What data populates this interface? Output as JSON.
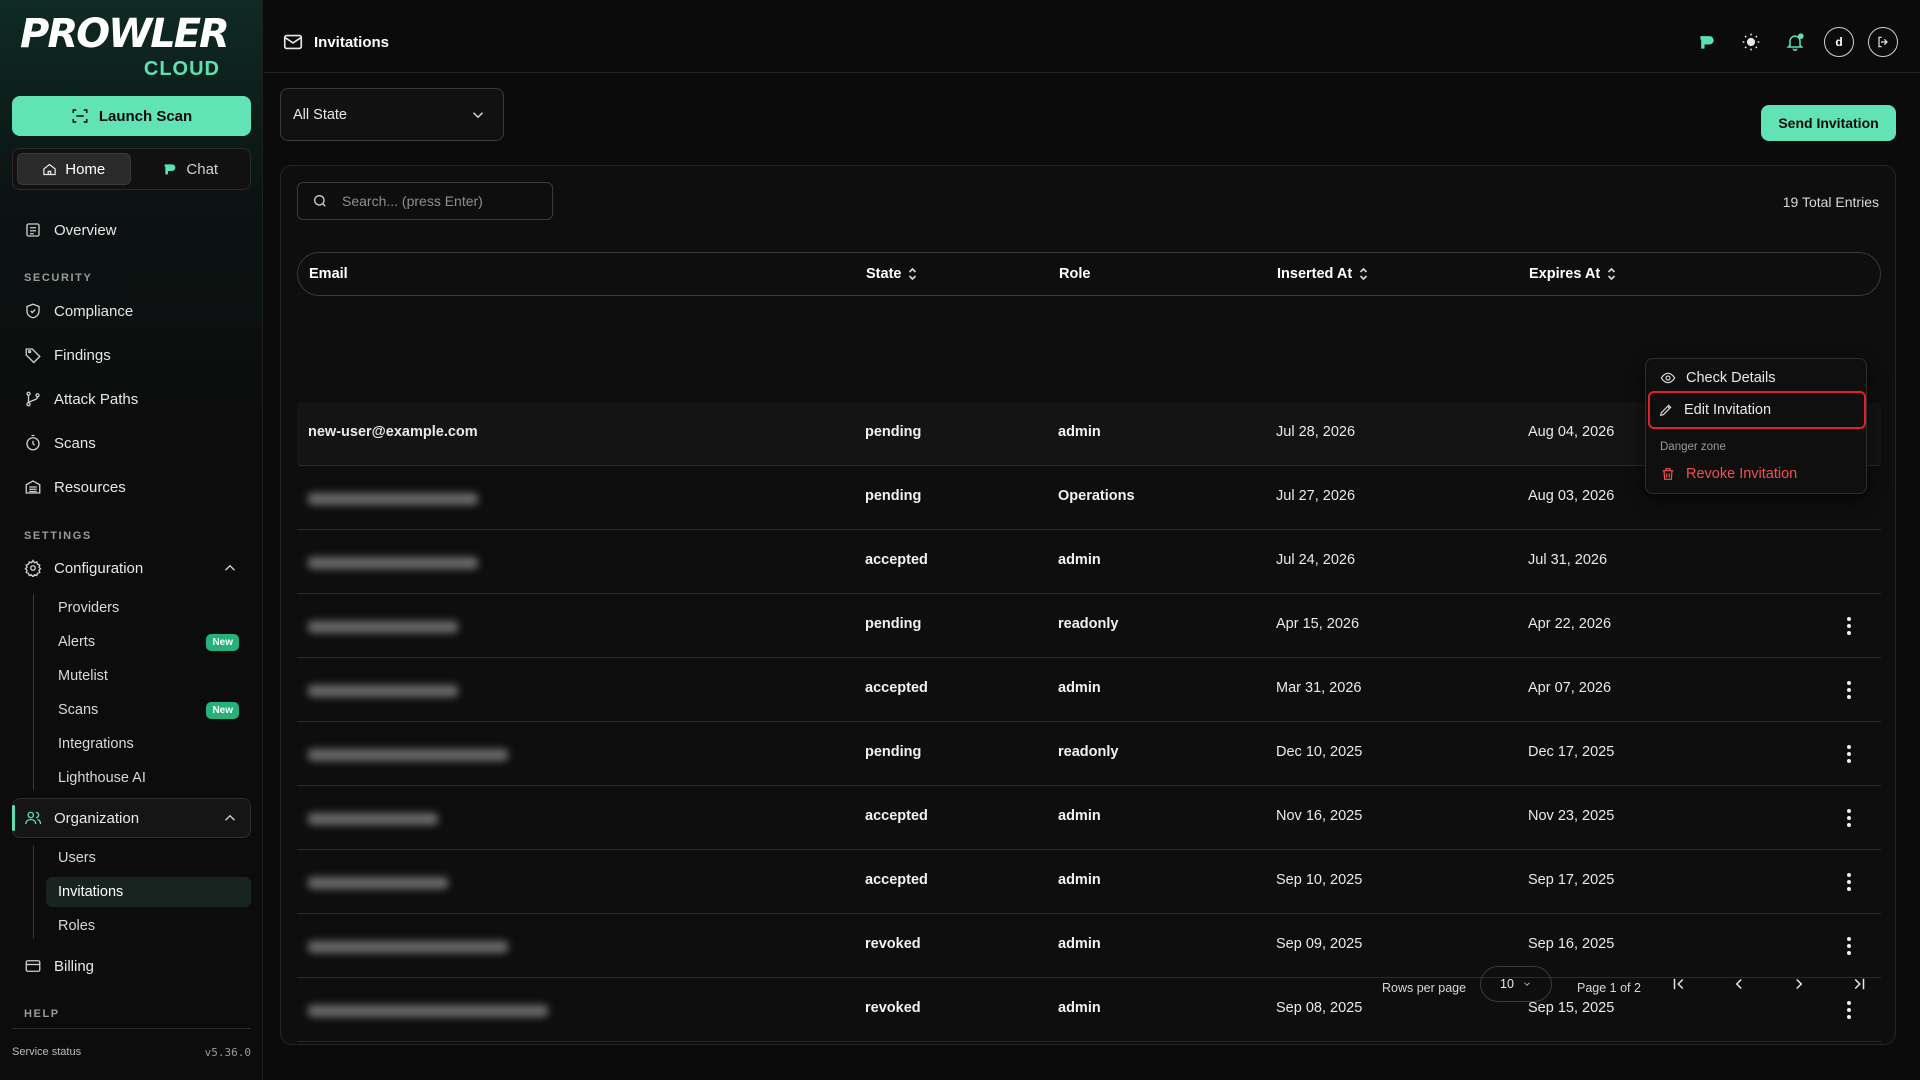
{
  "brand": {
    "name": "PROWLER",
    "sub": "CLOUD"
  },
  "sidebar": {
    "launch_label": "Launch Scan",
    "tabs": [
      {
        "label": "Home",
        "active": true
      },
      {
        "label": "Chat",
        "active": false
      }
    ],
    "overview": "Overview",
    "security_label": "SECURITY",
    "security_items": [
      "Compliance",
      "Findings",
      "Attack Paths",
      "Scans",
      "Resources"
    ],
    "settings_label": "SETTINGS",
    "configuration": "Configuration",
    "config_items": [
      {
        "label": "Providers"
      },
      {
        "label": "Alerts",
        "badge": "New"
      },
      {
        "label": "Mutelist"
      },
      {
        "label": "Scans",
        "badge": "New"
      },
      {
        "label": "Integrations"
      },
      {
        "label": "Lighthouse AI"
      }
    ],
    "organization": "Organization",
    "org_items": [
      "Users",
      "Invitations",
      "Roles"
    ],
    "billing": "Billing",
    "help_label": "HELP",
    "service_status": "Service status",
    "version": "v5.36.0"
  },
  "topbar": {
    "title": "Invitations",
    "avatar": "d"
  },
  "filters": {
    "state": "All State"
  },
  "actions": {
    "send": "Send Invitation"
  },
  "search": {
    "placeholder": "Search... (press Enter)"
  },
  "total_entries": "19 Total Entries",
  "table": {
    "columns": [
      "Email",
      "State",
      "Role",
      "Inserted At",
      "Expires At"
    ],
    "rows": [
      {
        "email": "new-user@example.com",
        "state": "pending",
        "role": "admin",
        "inserted": "Jul 28, 2026",
        "expires": "Aug 04, 2026"
      },
      {
        "email": "",
        "state": "pending",
        "role": "Operations",
        "inserted": "Jul 27, 2026",
        "expires": "Aug 03, 2026"
      },
      {
        "email": "",
        "state": "accepted",
        "role": "admin",
        "inserted": "Jul 24, 2026",
        "expires": "Jul 31, 2026"
      },
      {
        "email": "",
        "state": "pending",
        "role": "readonly",
        "inserted": "Apr 15, 2026",
        "expires": "Apr 22, 2026"
      },
      {
        "email": "",
        "state": "accepted",
        "role": "admin",
        "inserted": "Mar 31, 2026",
        "expires": "Apr 07, 2026"
      },
      {
        "email": "",
        "state": "pending",
        "role": "readonly",
        "inserted": "Dec 10, 2025",
        "expires": "Dec 17, 2025"
      },
      {
        "email": "",
        "state": "accepted",
        "role": "admin",
        "inserted": "Nov 16, 2025",
        "expires": "Nov 23, 2025"
      },
      {
        "email": "",
        "state": "accepted",
        "role": "admin",
        "inserted": "Sep 10, 2025",
        "expires": "Sep 17, 2025"
      },
      {
        "email": "",
        "state": "revoked",
        "role": "admin",
        "inserted": "Sep 09, 2025",
        "expires": "Sep 16, 2025"
      },
      {
        "email": "",
        "state": "revoked",
        "role": "admin",
        "inserted": "Sep 08, 2025",
        "expires": "Sep 15, 2025"
      }
    ]
  },
  "menu": {
    "check_details": "Check Details",
    "edit": "Edit Invitation",
    "danger_zone": "Danger zone",
    "revoke": "Revoke Invitation"
  },
  "pagination": {
    "rows_per_page_label": "Rows per page",
    "rows_per_page": "10",
    "page_info": "Page 1 of 2"
  },
  "colors": {
    "accent": "#62e3b5",
    "danger": "#f05050",
    "highlight": "#e0212b"
  }
}
